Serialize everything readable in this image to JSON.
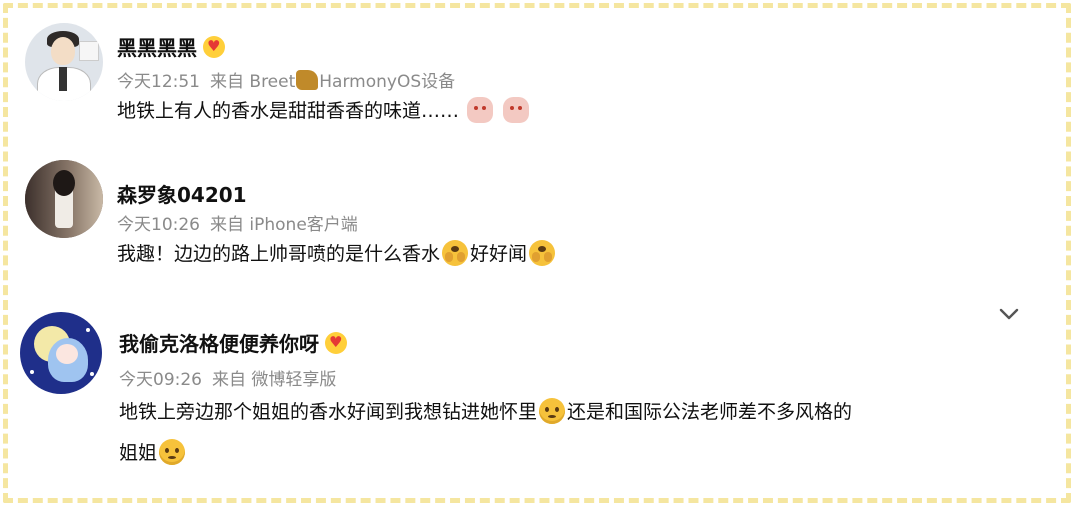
{
  "colors": {
    "frame_dash": "#f5e6a0",
    "meta_text": "#8a8a8a",
    "name_text": "#111111"
  },
  "comments": [
    {
      "avatar_icon": "avatar-icon",
      "username": "黑黑黑黑",
      "badge_icon": "crown-heart-icon",
      "time": "今天12:51",
      "source_prefix": "来自 Breet",
      "source_icon": "monkey-icon",
      "source_suffix": "HarmonyOS设备",
      "text": "地铁上有人的香水是甜甜香香的味道……",
      "trailing_emojis": [
        "doll-emoji",
        "doll-emoji"
      ]
    },
    {
      "avatar_icon": "avatar-icon",
      "username": "森罗象04201",
      "time": "今天10:26",
      "source": "来自 iPhone客户端",
      "text_part1": "我趣！边边的路上帅哥喷的是什么香水",
      "text_emoji1": "cover-face-emoji",
      "text_part2": "好好闻",
      "text_emoji2": "cover-face-emoji"
    },
    {
      "avatar_icon": "avatar-icon",
      "username": "我偷克洛格便便养你呀",
      "badge_icon": "crown-heart-icon",
      "time": "今天09:26",
      "source": "来自 微博轻享版",
      "line1_part1": "地铁上旁边那个姐姐的香水好闻到我想钻进她怀里",
      "line1_emoji": "pleading-face-emoji",
      "line1_part2": "还是和国际公法老师差不多风格的",
      "line2_part1": "姐姐",
      "line2_emoji": "pleading-face-emoji"
    }
  ],
  "expand_icon": "chevron-down-icon"
}
